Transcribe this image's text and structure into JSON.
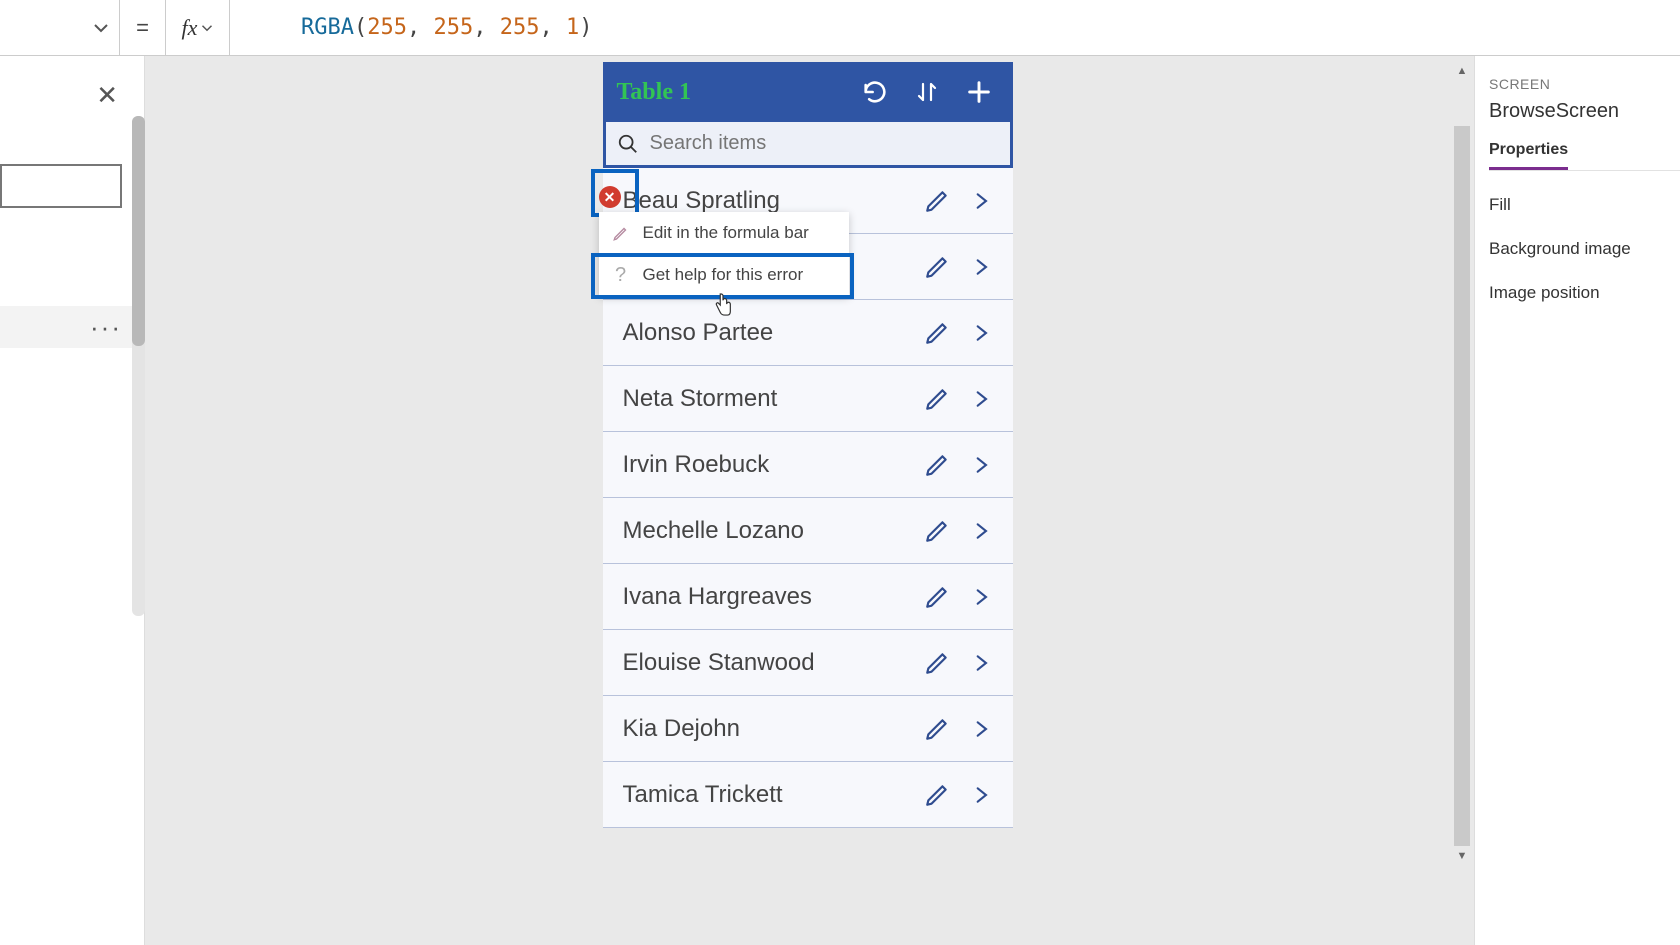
{
  "formulaBar": {
    "equals": "=",
    "fx": "fx",
    "parts": {
      "fn": "RGBA",
      "open": "(",
      "n1": "255",
      "c1": ", ",
      "n2": "255",
      "c2": ", ",
      "n3": "255",
      "c3": ", ",
      "n4": "1",
      "close": ")"
    }
  },
  "leftPane": {
    "dots": "···"
  },
  "app": {
    "title": "Table 1",
    "search_placeholder": "Search items",
    "items": [
      {
        "name": "Beau Spratling"
      },
      {
        "name": ""
      },
      {
        "name": "Alonso Partee"
      },
      {
        "name": "Neta Storment"
      },
      {
        "name": "Irvin Roebuck"
      },
      {
        "name": "Mechelle Lozano"
      },
      {
        "name": "Ivana Hargreaves"
      },
      {
        "name": "Elouise Stanwood"
      },
      {
        "name": "Kia Dejohn"
      },
      {
        "name": "Tamica Trickett"
      }
    ],
    "error_badge": "✕"
  },
  "contextMenu": {
    "edit": "Edit in the formula bar",
    "help": "Get help for this error"
  },
  "rightPane": {
    "category": "SCREEN",
    "name": "BrowseScreen",
    "tab": "Properties",
    "props": {
      "fill": "Fill",
      "bgimg": "Background image",
      "imgpos": "Image position"
    }
  }
}
